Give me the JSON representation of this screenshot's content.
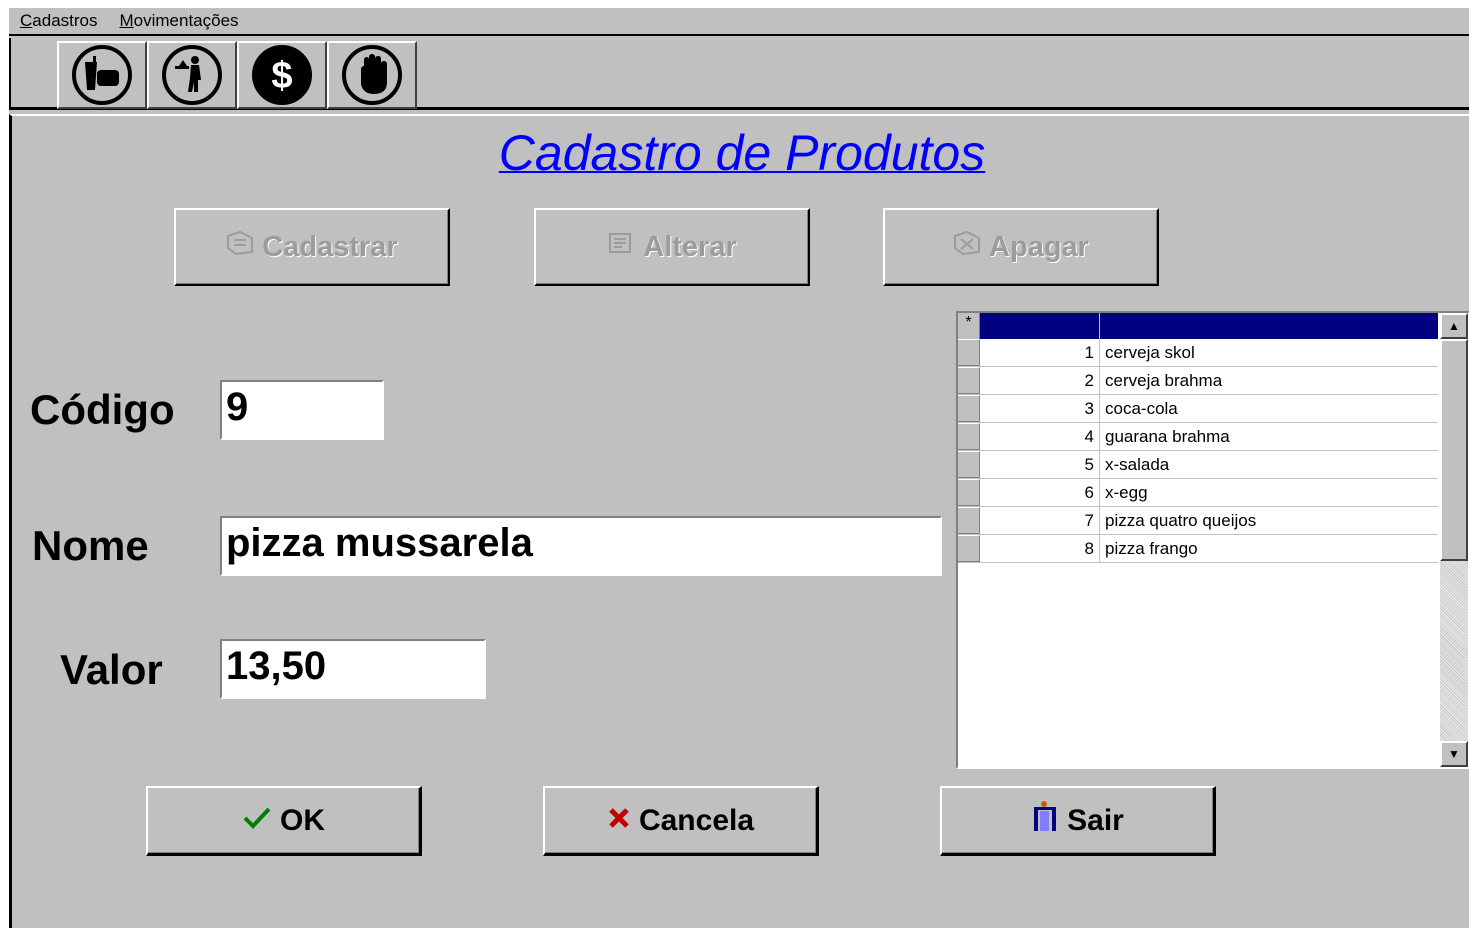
{
  "menu": {
    "items": [
      {
        "accel": "C",
        "rest": "adastros"
      },
      {
        "accel": "M",
        "rest": "ovimentações"
      }
    ]
  },
  "toolbar": {
    "icons": [
      "food-drink-icon",
      "waiter-icon",
      "dollar-icon",
      "hand-stop-icon"
    ]
  },
  "form": {
    "title": "Cadastro de Produtos",
    "actions": {
      "cadastrar": "Cadastrar",
      "alterar": "Alterar",
      "apagar": "Apagar"
    },
    "fields": {
      "codigo_label": "Código",
      "codigo_value": "9",
      "nome_label": "Nome",
      "nome_value": "pizza mussarela",
      "valor_label": "Valor",
      "valor_value": "13,50"
    },
    "footer": {
      "ok": "OK",
      "cancela": "Cancela",
      "sair": "Sair"
    }
  },
  "grid": {
    "header_marker": "*",
    "rows": [
      {
        "id": "1",
        "name": "cerveja skol"
      },
      {
        "id": "2",
        "name": "cerveja brahma"
      },
      {
        "id": "3",
        "name": "coca-cola"
      },
      {
        "id": "4",
        "name": "guarana brahma"
      },
      {
        "id": "5",
        "name": "x-salada"
      },
      {
        "id": "6",
        "name": "x-egg"
      },
      {
        "id": "7",
        "name": "pizza quatro queijos"
      },
      {
        "id": "8",
        "name": "pizza frango"
      }
    ]
  },
  "colors": {
    "title": "#0000ff",
    "grid_header": "#000080",
    "window": "#c0c0c0",
    "ok_check": "#008000",
    "cancel_x": "#c00000"
  }
}
